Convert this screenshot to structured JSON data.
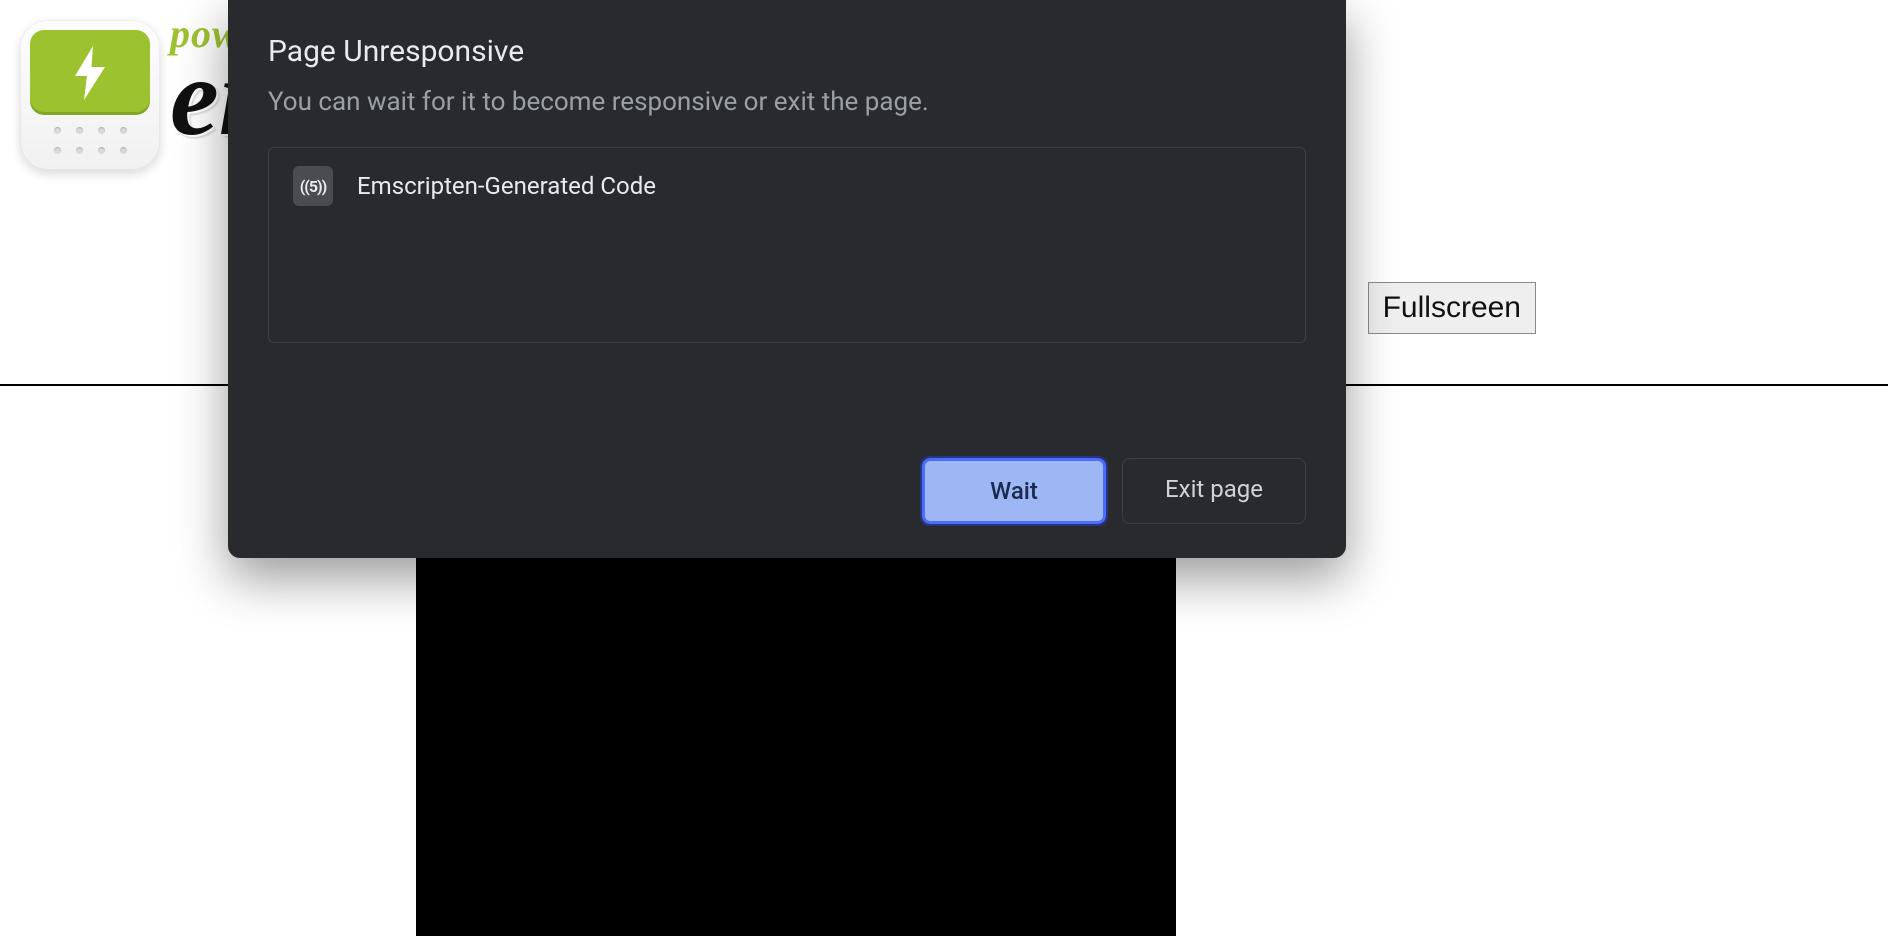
{
  "page": {
    "logo_powered": "powered by",
    "logo_name": "emscripten",
    "fullscreen_label": "Fullscreen"
  },
  "dialog": {
    "title": "Page Unresponsive",
    "subtitle": "You can wait for it to become responsive or exit the page.",
    "items": [
      {
        "icon_text": "((5))",
        "label": "Emscripten-Generated Code"
      }
    ],
    "wait_label": "Wait",
    "exit_label": "Exit page"
  }
}
